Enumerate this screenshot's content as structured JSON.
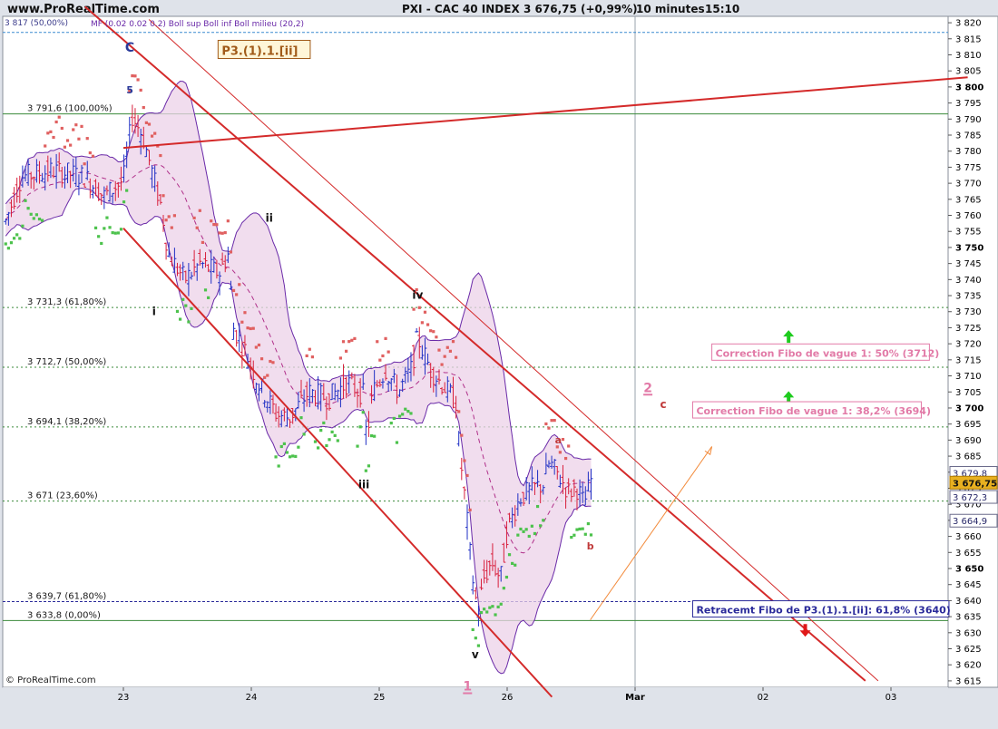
{
  "header": {
    "site": "www.ProRealTime.com",
    "title": "PXI - CAC 40 INDEX",
    "price_change": "3 676,75 (+0,99%)",
    "period": "10 minutes",
    "time": "15:10",
    "legend_indicators": "MF (0.02 0.02 0.2)   Boll sup Boll inf Boll milieu (20,2)",
    "legend_top_level": "3 817 (50,00%)"
  },
  "footer": {
    "copyright": "© ProRealTime.com"
  },
  "colors": {
    "band_fill": "#ecd2e8",
    "band_line": "#6a2aa8",
    "candle": "#1f2fc4",
    "candle_red": "#d81f3c",
    "sar_up": "#4cc24c",
    "sar_down": "#e06060",
    "channel": "#d42a2a",
    "fib_line": "#3a8a3a",
    "fib_blue": "#2a2a9a",
    "pink": "#e27aa7",
    "orange": "#f28a3a",
    "green_arrow": "#1ecb1e"
  },
  "chart_data": {
    "type": "candlestick",
    "instrument": "PXI - CAC 40 INDEX",
    "timeframe": "10 minutes",
    "last_price": 3676.75,
    "change_pct": 0.99,
    "x_tick_labels": [
      "23",
      "24",
      "25",
      "26",
      "Mar",
      "02",
      "03"
    ],
    "y_range": [
      3613,
      3822
    ],
    "y_ticks": [
      3615,
      3620,
      3625,
      3630,
      3635,
      3640,
      3645,
      3650,
      3655,
      3660,
      3665,
      3670,
      3675,
      3680,
      3685,
      3690,
      3695,
      3700,
      3705,
      3710,
      3715,
      3720,
      3725,
      3730,
      3735,
      3740,
      3745,
      3750,
      3755,
      3760,
      3765,
      3770,
      3775,
      3780,
      3785,
      3790,
      3795,
      3800,
      3805,
      3810,
      3815,
      3820
    ],
    "y_tick_labels": [
      "3 615",
      "3 620",
      "3 625",
      "3 630",
      "3 635",
      "3 640",
      "3 645",
      "3 650",
      "3 655",
      "3 660",
      "3 665",
      "3 670",
      "3 675",
      "3 680",
      "3 685",
      "3 690",
      "3 695",
      "3 700",
      "3 705",
      "3 710",
      "3 715",
      "3 720",
      "3 725",
      "3 730",
      "3 735",
      "3 740",
      "3 745",
      "3 750",
      "3 755",
      "3 760",
      "3 765",
      "3 770",
      "3 775",
      "3 780",
      "3 785",
      "3 790",
      "3 795",
      "3 800",
      "3 805",
      "3 810",
      "3 815",
      "3 820"
    ],
    "y_bold_ticks": [
      3650,
      3700,
      3750,
      3800
    ],
    "price_badges": [
      {
        "value": 3679.8,
        "label": "3 679,8",
        "style": "plain"
      },
      {
        "value": 3676.75,
        "label": "3 676,75",
        "style": "highlight"
      },
      {
        "value": 3672.3,
        "label": "3 672,3",
        "style": "plain"
      },
      {
        "value": 3664.9,
        "label": "3 664,9",
        "style": "plain"
      }
    ],
    "fib_levels": [
      {
        "value": 3817,
        "label": "3 817 (50,00%)",
        "style": "blue"
      },
      {
        "value": 3791.6,
        "label": "3 791,6 (100,00%)",
        "style": "solid"
      },
      {
        "value": 3731.3,
        "label": "3 731,3 (61,80%)",
        "style": "dotted"
      },
      {
        "value": 3712.7,
        "label": "3 712,7 (50,00%)",
        "style": "dotted"
      },
      {
        "value": 3694.1,
        "label": "3 694,1 (38,20%)",
        "style": "dotted"
      },
      {
        "value": 3671,
        "label": "3 671 (23,60%)",
        "style": "dotted"
      },
      {
        "value": 3639.7,
        "label": "3 639,7 (61,80%)",
        "style": "blue"
      },
      {
        "value": 3633.8,
        "label": "3 633,8 (0,00%)",
        "style": "solid"
      }
    ],
    "channel_lines": [
      {
        "from": [
          0.0,
          3781
        ],
        "to": [
          6.6,
          3803
        ],
        "weight": 2
      },
      {
        "from": [
          -0.3,
          3825
        ],
        "to": [
          5.8,
          3615
        ],
        "weight": 2
      },
      {
        "from": [
          0.2,
          3821
        ],
        "to": [
          5.9,
          3615
        ],
        "weight": 1
      },
      {
        "from": [
          0.0,
          3756
        ],
        "to": [
          3.35,
          3610
        ],
        "weight": 2
      }
    ],
    "wave_labels": [
      {
        "text": "C",
        "x": 0.05,
        "y": 3811,
        "color": "#2a3a9a",
        "size": 14
      },
      {
        "text": "5",
        "x": 0.05,
        "y": 3798,
        "color": "#2a3a9a",
        "size": 11
      },
      {
        "text": "i",
        "x": 0.24,
        "y": 3729,
        "color": "#111",
        "size": 12
      },
      {
        "text": "ii",
        "x": 1.14,
        "y": 3758,
        "color": "#111",
        "size": 12
      },
      {
        "text": "iii",
        "x": 1.88,
        "y": 3675,
        "color": "#111",
        "size": 12
      },
      {
        "text": "iv",
        "x": 2.3,
        "y": 3734,
        "color": "#111",
        "size": 12
      },
      {
        "text": "v",
        "x": 2.75,
        "y": 3622,
        "color": "#111",
        "size": 12
      },
      {
        "text": "1",
        "x": 2.69,
        "y": 3612,
        "color": "#e27aa7",
        "size": 14,
        "underline": true
      },
      {
        "text": "2",
        "x": 4.1,
        "y": 3705,
        "color": "#e27aa7",
        "size": 14,
        "underline": true
      },
      {
        "text": "c",
        "x": 4.22,
        "y": 3700,
        "color": "#c03a3a",
        "size": 12
      },
      {
        "text": "a",
        "x": 3.4,
        "y": 3689,
        "color": "#c03a3a",
        "size": 11
      },
      {
        "text": "b",
        "x": 3.65,
        "y": 3656,
        "color": "#c03a3a",
        "size": 11
      }
    ],
    "annotations": [
      {
        "text": "P3.(1).1.[ii]",
        "x": 0.74,
        "y": 3810,
        "style": "boxed"
      },
      {
        "text": "Correction Fibo de vague 1: 50% (3712)",
        "x": 4.6,
        "y": 3716,
        "style": "pink"
      },
      {
        "text": "Correction Fibo de vague 1: 38,2% (3694)",
        "x": 4.45,
        "y": 3698,
        "style": "pink"
      },
      {
        "text": "Retracemt Fibo de P3.(1).1.[ii]: 61,8% (3640)",
        "x": 4.45,
        "y": 3636,
        "style": "blue"
      }
    ],
    "arrows": [
      {
        "kind": "up",
        "x": 5.2,
        "y": 3722,
        "color": "#1ecb1e"
      },
      {
        "kind": "up",
        "x": 5.2,
        "y": 3703,
        "color": "#1ecb1e"
      },
      {
        "kind": "down",
        "x": 5.33,
        "y": 3631,
        "color": "#e01818"
      },
      {
        "kind": "line",
        "from": [
          3.65,
          3634
        ],
        "to": [
          4.6,
          3688
        ],
        "color": "#f28a3a"
      }
    ]
  }
}
